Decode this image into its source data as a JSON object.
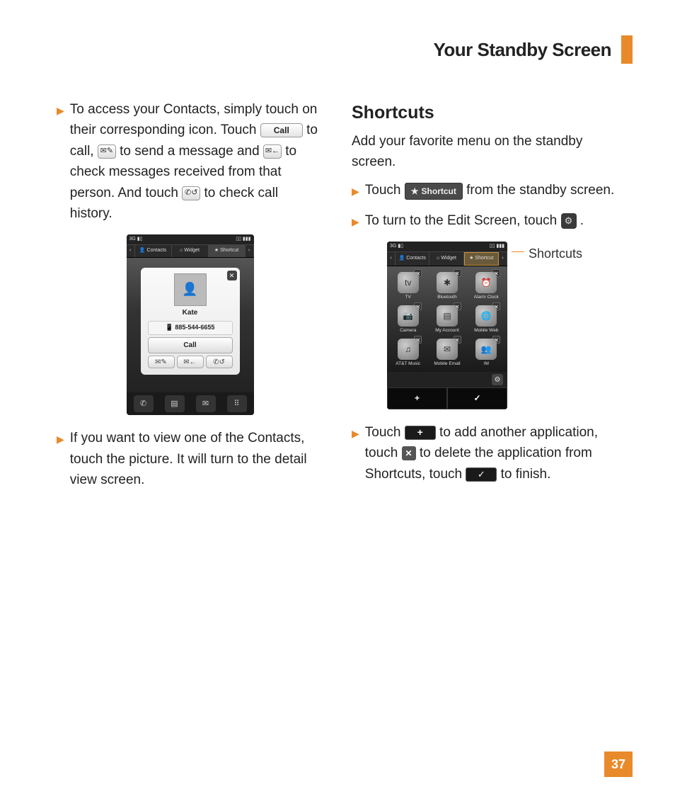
{
  "header": {
    "title": "Your Standby Screen"
  },
  "left": {
    "b1_pre": "To access your Contacts, simply touch on their corresponding icon. Touch ",
    "call_label": "Call",
    "b1_mid1": " to call, ",
    "b1_mid2": " to send a message and ",
    "b1_mid3": " to check messages received from that person. And touch ",
    "b1_end": " to check call history.",
    "b2": "If you want to view one of the Contacts, touch the picture. It will turn to the detail view screen."
  },
  "phone1": {
    "status_left": "3G ▮▯",
    "status_right": "▯▯ ▮▮▮",
    "tabs": {
      "arrow_l": "‹",
      "contacts": "Contacts",
      "widget": "Widget",
      "shortcut": "Shortcut",
      "arrow_r": "›"
    },
    "contact": {
      "name": "Kate",
      "number": "885-544-6655",
      "call": "Call"
    }
  },
  "right": {
    "heading": "Shortcuts",
    "intro": "Add your favorite menu on the standby screen.",
    "r1_pre": "Touch ",
    "shortcut_btn": "Shortcut",
    "r1_post": " from the standby screen.",
    "r2_pre": "To turn to the Edit Screen, touch ",
    "r2_post": ".",
    "callout": "Shortcuts",
    "r3_pre": "Touch ",
    "r3_mid1": " to add another application, touch ",
    "r3_mid2": " to delete the application from Shortcuts, touch ",
    "r3_end": " to finish."
  },
  "phone2": {
    "apps": [
      {
        "label": "TV",
        "glyph": "tv"
      },
      {
        "label": "Bluetooth",
        "glyph": "✱"
      },
      {
        "label": "Alarm Clock",
        "glyph": "⏰"
      },
      {
        "label": "Camera",
        "glyph": "📷"
      },
      {
        "label": "My Account",
        "glyph": "▤"
      },
      {
        "label": "Mobile Web",
        "glyph": "🌐"
      },
      {
        "label": "AT&T Music",
        "glyph": "♫"
      },
      {
        "label": "Mobile Email",
        "glyph": "✉"
      },
      {
        "label": "IM",
        "glyph": "👥"
      }
    ]
  },
  "page": "37"
}
